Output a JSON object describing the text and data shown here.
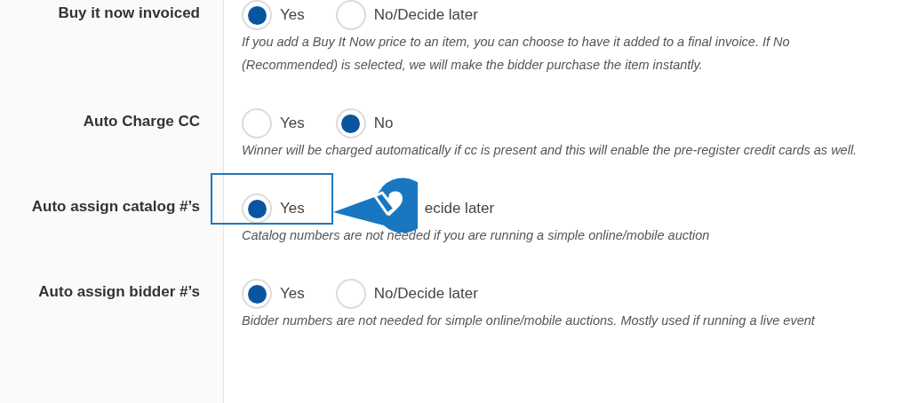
{
  "settings": [
    {
      "label": "Buy it now invoiced",
      "highlighted": false,
      "options": [
        {
          "label": "Yes",
          "selected": true
        },
        {
          "label": "No/Decide later",
          "selected": false
        }
      ],
      "description": "If you add a Buy It Now price to an item, you can choose to have it added to a final invoice. If No (Recommended) is selected, we will make the bidder purchase the item instantly."
    },
    {
      "label": "Auto Charge CC",
      "highlighted": false,
      "options": [
        {
          "label": "Yes",
          "selected": false
        },
        {
          "label": "No",
          "selected": true
        }
      ],
      "description": "Winner will be charged automatically if cc is present and this will enable the pre-register credit cards as well."
    },
    {
      "label": "Auto assign catalog #’s",
      "highlighted": true,
      "options": [
        {
          "label": "Yes",
          "selected": true
        },
        {
          "label": "ecide later",
          "partly_covered": true
        }
      ],
      "description": "Catalog numbers are not needed if you are running a simple online/mobile auction"
    },
    {
      "label": "Auto assign bidder #’s",
      "highlighted": false,
      "options": [
        {
          "label": "Yes",
          "selected": true
        },
        {
          "label": "No/Decide later",
          "selected": false
        }
      ],
      "description": "Bidder numbers are not needed for simple online/mobile auctions. Mostly used if running a live event"
    }
  ]
}
